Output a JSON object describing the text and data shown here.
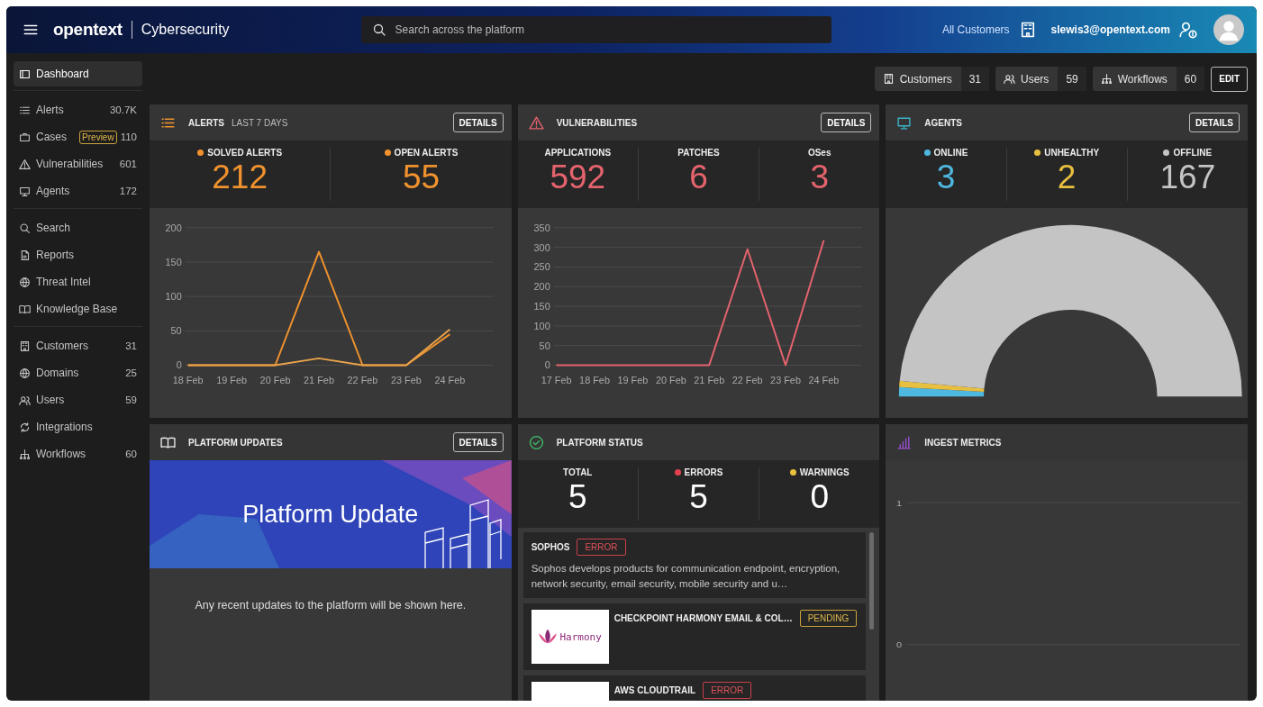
{
  "header": {
    "brand": "opentext",
    "product": "Cybersecurity",
    "search": {
      "placeholder": "Search across the platform"
    },
    "customer_scope": "All Customers",
    "user_email": "slewis3@opentext.com"
  },
  "sidebar": {
    "groups": [
      [
        {
          "label": "Dashboard",
          "selected": true
        }
      ],
      [
        {
          "label": "Alerts",
          "count": "30.7K",
          "selected": false
        },
        {
          "label": "Cases",
          "badge": "Preview",
          "count": "110",
          "selected": false
        },
        {
          "label": "Vulnerabilities",
          "count": "601",
          "selected": false
        },
        {
          "label": "Agents",
          "count": "172",
          "selected": false
        }
      ],
      [
        {
          "label": "Search",
          "selected": false
        },
        {
          "label": "Reports",
          "selected": false
        },
        {
          "label": "Threat Intel",
          "selected": false
        },
        {
          "label": "Knowledge Base",
          "selected": false
        }
      ],
      [
        {
          "label": "Customers",
          "count": "31",
          "selected": false
        },
        {
          "label": "Domains",
          "count": "25",
          "selected": false
        },
        {
          "label": "Users",
          "count": "59",
          "selected": false
        },
        {
          "label": "Integrations",
          "selected": false
        },
        {
          "label": "Workflows",
          "count": "60",
          "selected": false
        }
      ]
    ]
  },
  "summary": {
    "chips": [
      {
        "label": "Customers",
        "count": "31"
      },
      {
        "label": "Users",
        "count": "59"
      },
      {
        "label": "Workflows",
        "count": "60"
      }
    ],
    "edit_button": "EDIT"
  },
  "alerts_card": {
    "title": "ALERTS",
    "subtitle": "LAST 7 DAYS",
    "details_button": "DETAILS",
    "colored_values": true,
    "stats": [
      {
        "label": "SOLVED ALERTS",
        "value": "212",
        "dot": true,
        "color": "#f0922e"
      },
      {
        "label": "OPEN ALERTS",
        "value": "55",
        "dot": true,
        "color": "#f0922e"
      }
    ],
    "chart_data": {
      "type": "line",
      "categories": [
        "18 Feb",
        "19 Feb",
        "20 Feb",
        "21 Feb",
        "22 Feb",
        "23 Feb",
        "24 Feb"
      ],
      "ylim": [
        0,
        200
      ],
      "yticks": [
        0,
        50,
        100,
        150,
        200
      ],
      "grid": true,
      "series": [
        {
          "color": "#f0922e",
          "values": [
            0,
            0,
            0,
            165,
            0,
            0,
            45
          ]
        },
        {
          "color": "#e9a24a",
          "values": [
            0,
            0,
            0,
            10,
            0,
            0,
            52
          ]
        }
      ]
    }
  },
  "vulnerabilities_card": {
    "title": "VULNERABILITIES",
    "details_button": "DETAILS",
    "colored_values": true,
    "stats": [
      {
        "label": "APPLICATIONS",
        "value": "592",
        "dot": false,
        "color": "#e5636d"
      },
      {
        "label": "PATCHES",
        "value": "6",
        "dot": false,
        "color": "#e5636d"
      },
      {
        "label": "OSes",
        "value": "3",
        "dot": false,
        "color": "#e5636d"
      }
    ],
    "chart_data": {
      "type": "line",
      "categories": [
        "17 Feb",
        "18 Feb",
        "19 Feb",
        "20 Feb",
        "21 Feb",
        "22 Feb",
        "23 Feb",
        "24 Feb"
      ],
      "ylim": [
        0,
        350
      ],
      "yticks": [
        0,
        50,
        100,
        150,
        200,
        250,
        300,
        350
      ],
      "grid": true,
      "series": [
        {
          "color": "#e5636d",
          "values": [
            0,
            0,
            0,
            0,
            0,
            295,
            0,
            318
          ]
        }
      ]
    }
  },
  "agents_card": {
    "title": "AGENTS",
    "details_button": "DETAILS",
    "colored_values": true,
    "stats": [
      {
        "label": "ONLINE",
        "value": "3",
        "dot": true,
        "color": "#4fb8e0"
      },
      {
        "label": "UNHEALTHY",
        "value": "2",
        "dot": true,
        "color": "#e8c040"
      },
      {
        "label": "OFFLINE",
        "value": "167",
        "dot": true,
        "color": "#c4c4c4"
      }
    ]
  },
  "platform_updates_card": {
    "title": "PLATFORM UPDATES",
    "details_button": "DETAILS",
    "banner_title": "Platform Update",
    "message": "Any recent updates to the platform will be shown here."
  },
  "platform_status_card": {
    "title": "PLATFORM STATUS",
    "colored_values": false,
    "stats": [
      {
        "label": "TOTAL",
        "value": "5",
        "dot": false
      },
      {
        "label": "ERRORS",
        "value": "5",
        "dot": true,
        "color": "#e5404f"
      },
      {
        "label": "WARNINGS",
        "value": "0",
        "dot": true,
        "color": "#e8c040"
      }
    ],
    "items": [
      {
        "name": "SOPHOS",
        "status": "ERROR",
        "kind": "error",
        "logo": false,
        "description": "Sophos develops products for communication endpoint, encryption, network security, email security, mobile security and u…"
      },
      {
        "name": "CHECKPOINT HARMONY EMAIL & COL…",
        "status": "PENDING",
        "kind": "pending",
        "logo": true,
        "logo_text": "Harmony"
      },
      {
        "name": "AWS CLOUDTRAIL",
        "status": "ERROR",
        "kind": "error",
        "logo": true
      }
    ]
  },
  "ingest_metrics_card": {
    "title": "INGEST METRICS",
    "axis_labels": [
      "1",
      "0"
    ]
  }
}
